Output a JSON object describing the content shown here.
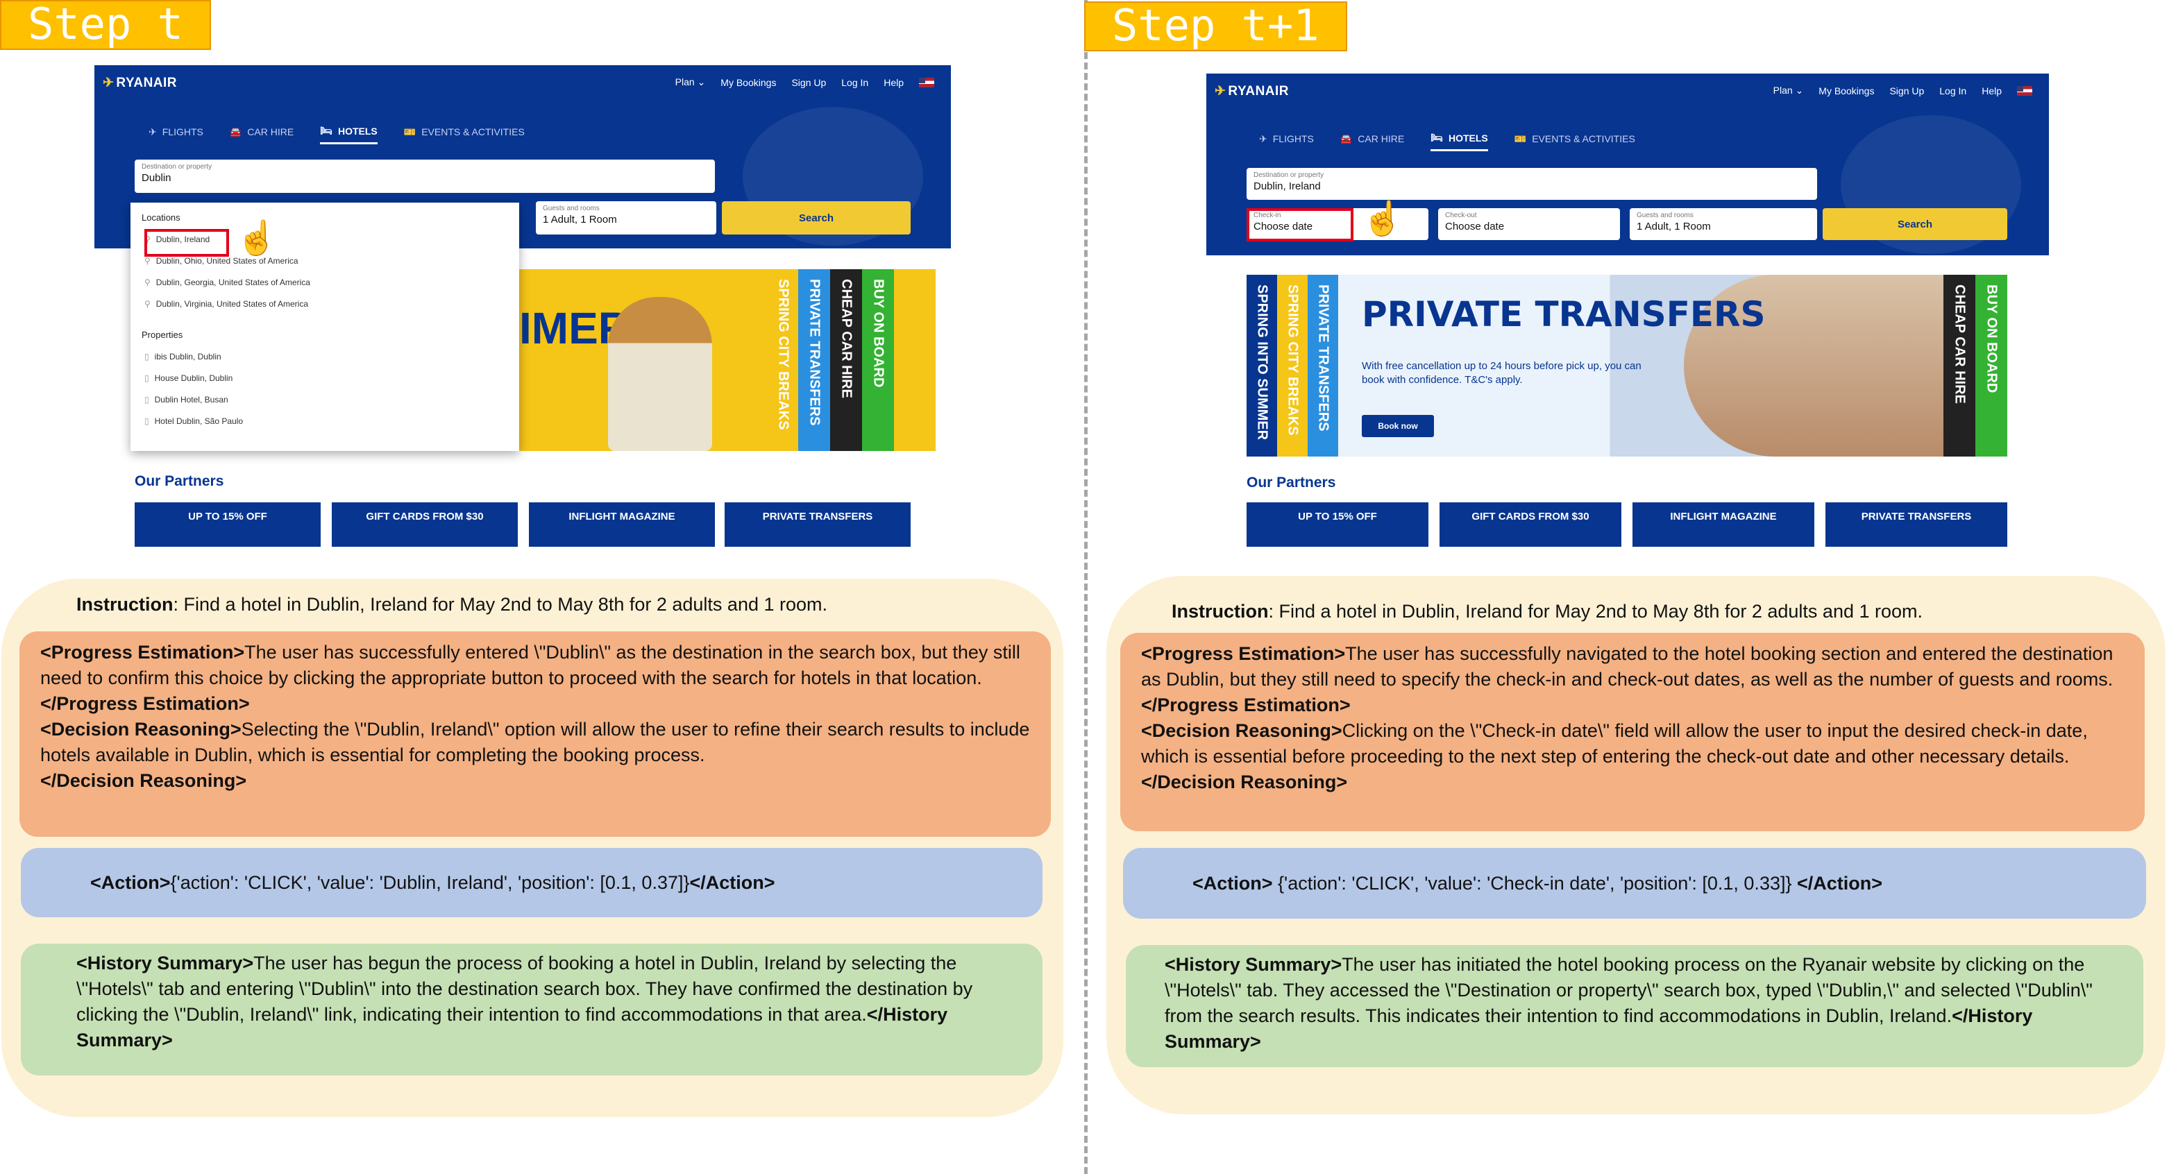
{
  "colors": {
    "badge": "#ffc000",
    "ryanair_blue": "#073590",
    "ryanair_yellow": "#f1c933",
    "highlight_red": "#e2001a",
    "panel": "#fdf1d5",
    "reasoning_box": "#f4b183",
    "action_box": "#b4c7e7",
    "summary_box": "#c5e0b4"
  },
  "left": {
    "badge": "Step t",
    "site": {
      "brand": "RYANAIR",
      "nav": [
        "Plan ⌄",
        "My Bookings",
        "Sign Up",
        "Log In",
        "Help"
      ],
      "tabs": [
        "FLIGHTS",
        "CAR HIRE",
        "HOTELS",
        "EVENTS & ACTIVITIES"
      ],
      "tab_icons": [
        "plane-icon",
        "car-icon",
        "bed-icon",
        "ticket-icon"
      ],
      "active_tab": "HOTELS",
      "destination_label": "Destination or property",
      "destination_value": "Dublin",
      "guests_label": "Guests and rooms",
      "guests_value": "1 Adult, 1 Room",
      "search": "Search",
      "dropdown": {
        "locations_header": "Locations",
        "locations": [
          "Dublin, Ireland",
          "Dublin, Ohio, United States of America",
          "Dublin, Georgia, United States of America",
          "Dublin, Virginia, United States of America"
        ],
        "properties_header": "Properties",
        "properties": [
          "ibis Dublin, Dublin",
          "House Dublin, Dublin",
          "Dublin Hotel, Busan",
          "Hotel Dublin, São Paulo"
        ]
      },
      "banner_text": "IMER",
      "strips": [
        "SPRING CITY BREAKS",
        "PRIVATE TRANSFERS",
        "CHEAP CAR HIRE",
        "BUY ON BOARD"
      ],
      "partners_title": "Our Partners",
      "partners": [
        "UP TO 15% OFF",
        "GIFT CARDS FROM $30",
        "INFLIGHT MAGAZINE",
        "PRIVATE TRANSFERS"
      ]
    },
    "instruction_label": "Instruction",
    "instruction": ": Find a hotel in Dublin, Ireland for May 2nd to May 8th for 2 adults and 1 room.",
    "progress_open": "<Progress Estimation>",
    "progress_text": "The user has successfully entered \\\"Dublin\\\" as the destination in the search box, but they still need to confirm this choice by clicking the appropriate button to proceed with the search for hotels in that location.",
    "progress_close": "</Progress Estimation>",
    "decision_open": "<Decision Reasoning>",
    "decision_text": "Selecting the \\\"Dublin, Ireland\\\" option will allow the user to refine their search results to include hotels available in Dublin, which is essential for completing the booking process.",
    "decision_close": "</Decision Reasoning>",
    "action_open": "<Action>",
    "action_text": "{'action': 'CLICK', 'value': 'Dublin, Ireland', 'position': [0.1, 0.37]}",
    "action_close": "</Action>",
    "history_open": "<History Summary>",
    "history_text": "The user has begun the process of booking a hotel in Dublin, Ireland by selecting the \\\"Hotels\\\" tab and entering \\\"Dublin\\\" into the destination search box. They have confirmed the destination by clicking the \\\"Dublin, Ireland\\\" link, indicating their intention to find accommodations in that area.",
    "history_close": "</History Summary>"
  },
  "right": {
    "badge": "Step t+1",
    "site": {
      "brand": "RYANAIR",
      "nav": [
        "Plan ⌄",
        "My Bookings",
        "Sign Up",
        "Log In",
        "Help"
      ],
      "tabs": [
        "FLIGHTS",
        "CAR HIRE",
        "HOTELS",
        "EVENTS & ACTIVITIES"
      ],
      "tab_icons": [
        "plane-icon",
        "car-icon",
        "bed-icon",
        "ticket-icon"
      ],
      "active_tab": "HOTELS",
      "destination_label": "Destination or property",
      "destination_value": "Dublin, Ireland",
      "checkin_label": "Check-in",
      "checkin_value": "Choose date",
      "checkout_label": "Check-out",
      "checkout_value": "Choose date",
      "guests_label": "Guests and rooms",
      "guests_value": "1 Adult, 1 Room",
      "search": "Search",
      "strips_left": [
        "SPRING INTO SUMMER",
        "SPRING CITY BREAKS",
        "PRIVATE TRANSFERS"
      ],
      "promo_title": "PRIVATE TRANSFERS",
      "promo_sub": "With free cancellation up to 24 hours before pick up, you can book with confidence. T&C's apply.",
      "promo_cta": "Book now",
      "strips_right": [
        "CHEAP CAR HIRE",
        "BUY ON BOARD"
      ],
      "partners_title": "Our Partners",
      "partners": [
        "UP TO 15% OFF",
        "GIFT CARDS FROM $30",
        "INFLIGHT MAGAZINE",
        "PRIVATE TRANSFERS"
      ]
    },
    "instruction_label": "Instruction",
    "instruction": ": Find a hotel in Dublin, Ireland for May 2nd to May 8th for 2 adults and 1 room.",
    "progress_open": "<Progress Estimation>",
    "progress_text": "The user has successfully navigated to the hotel booking section and entered the destination as Dublin, but they still need to specify the check-in and check-out dates, as well as the number of guests and rooms.",
    "progress_close": "</Progress Estimation>",
    "decision_open": "<Decision Reasoning>",
    "decision_text": "Clicking on the \\\"Check-in date\\\" field will allow the user to input the desired check-in date, which is essential before proceeding to the next step of entering the check-out date and other necessary details.",
    "decision_close": "</Decision Reasoning>",
    "action_open": "<Action>",
    "action_text": " {'action': 'CLICK', 'value': 'Check-in date', 'position': [0.1, 0.33]} ",
    "action_close": "</Action>",
    "history_open": "<History Summary>",
    "history_text": "The user has initiated the hotel booking process on the Ryanair website by clicking on the \\\"Hotels\\\" tab. They accessed the \\\"Destination or property\\\" search box, typed \\\"Dublin,\\\" and selected \\\"Dublin\\\" from the search results. This indicates their intention to find accommodations in Dublin, Ireland.",
    "history_close": "</History Summary>"
  }
}
